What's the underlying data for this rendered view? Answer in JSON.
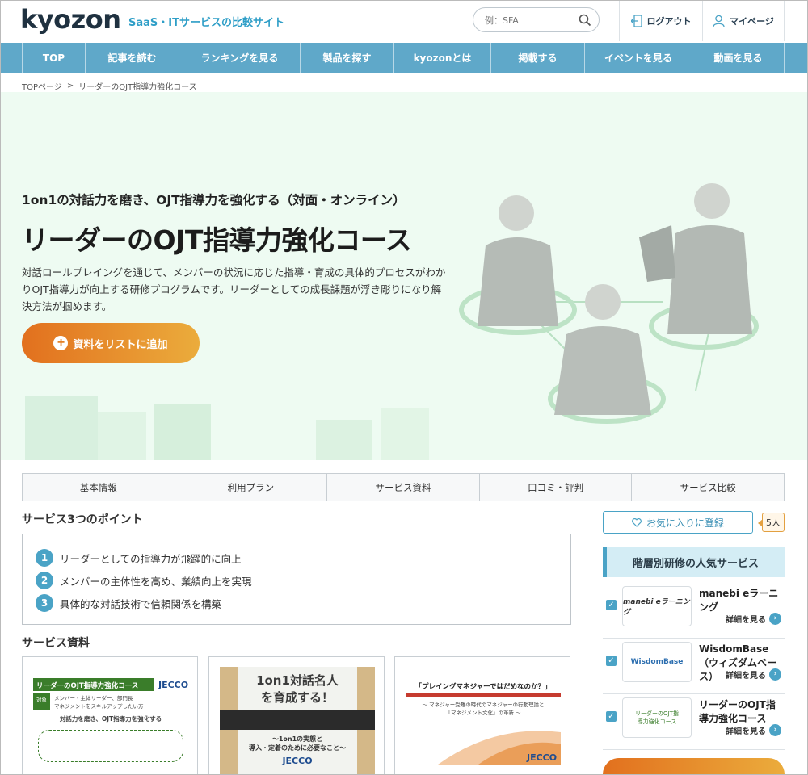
{
  "header": {
    "logo": "kyozon",
    "tagline": "SaaS・ITサービスの比較サイト",
    "search_placeholder": "例：SFA",
    "logout_label": "ログアウト",
    "mypage_label": "マイページ"
  },
  "nav": {
    "items": [
      "TOP",
      "記事を読む",
      "ランキングを見る",
      "製品を探す",
      "kyozonとは",
      "掲載する",
      "イベントを見る",
      "動画を見る"
    ]
  },
  "breadcrumb": {
    "home": "TOPページ",
    "separator": ">",
    "current": "リーダーのOJT指導力強化コース"
  },
  "hero": {
    "subtitle": "1on1の対話力を磨き、OJT指導力を強化する（対面・オンライン）",
    "title": "リーダーのOJT指導力強化コース",
    "description": "対話ロールプレイングを通じて、メンバーの状況に応じた指導・育成の具体的プロセスがわかりOJT指導力が向上する研修プログラムです。リーダーとしての成長課題が浮き彫りになり解決方法が掴めます。",
    "add_button": "資料をリストに追加",
    "colors": {
      "background": "#eefbf2",
      "button_start": "#e2701e",
      "button_end": "#ebac3c"
    }
  },
  "tabs": [
    "基本情報",
    "利用プラン",
    "サービス資料",
    "口コミ・評判",
    "サービス比較"
  ],
  "points": {
    "heading": "サービス3つのポイント",
    "items": [
      {
        "num": "1",
        "text": "リーダーとしての指導力が飛躍的に向上"
      },
      {
        "num": "2",
        "text": "メンバーの主体性を高め、業績向上を実現"
      },
      {
        "num": "3",
        "text": "具体的な対話技術で信頼関係を構築"
      }
    ]
  },
  "documents": {
    "heading": "サービス資料",
    "doc1": {
      "title": "リーダーのOJT指導力強化コース",
      "brand": "JECCO",
      "line1": "対象",
      "line2": "メンバー・主体リーダー、部門長",
      "line3": "マネジメントをスキルアップしたい方",
      "line4": "対話力を磨き、OJT指導力を強化する"
    },
    "doc2": {
      "title": "1on1対話名人",
      "title2": "を育成する！",
      "caption1": "〜1on1の実態と",
      "caption2": "導入・定着のために必要なこと〜",
      "brand": "JECCO"
    },
    "doc3": {
      "title": "「プレイングマネジャーではだめなのか？」",
      "caption1": "〜 マネジャー受難の時代のマネジャーの行動理論と",
      "caption2": "「マネジメント文化」の革新 〜",
      "brand": "JECCO"
    }
  },
  "sidebar": {
    "favorite_label": "お気に入りに登録",
    "favorite_count": "5人",
    "heading": "階層別研修の人気サービス",
    "services": [
      {
        "name": "manebi eラーニング",
        "thumb": "manebi eラーニング",
        "more": "詳細を見る"
      },
      {
        "name": "WisdomBase（ウィズダムベース）",
        "thumb": "WisdomBase",
        "more": "詳細を見る"
      },
      {
        "name": "リーダーのOJT指導力強化コース",
        "thumb": "リーダーのOJT指導力強化コース",
        "more": "詳細を見る"
      }
    ],
    "accent": "#4aa3c6"
  }
}
